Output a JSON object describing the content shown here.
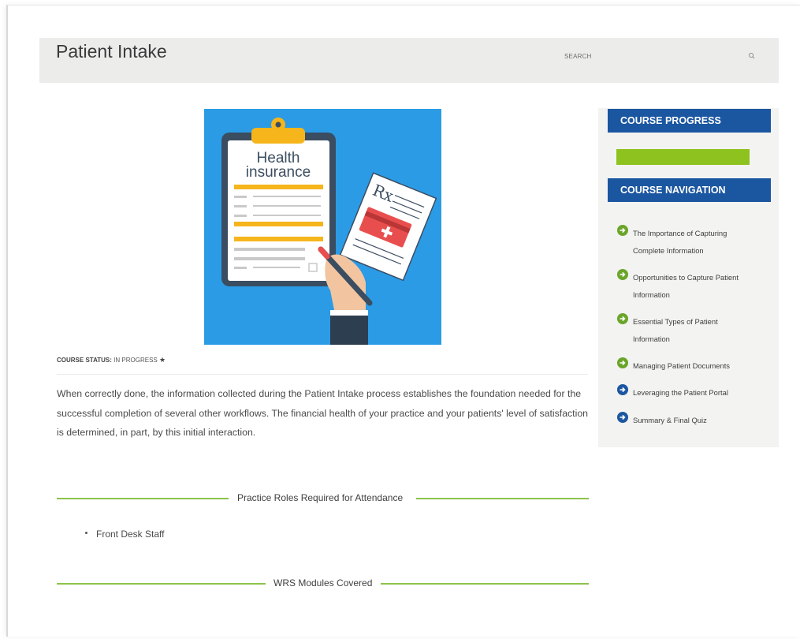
{
  "header": {
    "title": "Patient Intake",
    "search_label": "SEARCH",
    "search_icon": "search-icon"
  },
  "hero_image": {
    "title_line1": "Health",
    "title_line2": "insurance",
    "rx_label": "Rx",
    "colors": {
      "background": "#2b9be6",
      "clipboard": "#3b4d61",
      "accent": "#f5b51b",
      "card": "#e94e4e"
    }
  },
  "course_status": {
    "label": "COURSE STATUS:",
    "value": "IN PROGRESS",
    "icon": "star-icon"
  },
  "intro_text": "When correctly done, the information collected during the Patient Intake process establishes the foundation needed for the successful completion of several other workflows. The financial health of your practice and your patients' level of satisfaction is determined, in part, by this initial interaction.",
  "sections": [
    {
      "title": "Practice Roles Required for Attendance",
      "items": [
        "Front Desk Staff"
      ]
    },
    {
      "title": "WRS Modules Covered",
      "items": []
    }
  ],
  "sidebar": {
    "progress_heading": "COURSE PROGRESS",
    "progress_fraction": 1.0,
    "navigation_heading": "COURSE NAVIGATION",
    "items": [
      {
        "line1": "The Importance of Capturing",
        "line2": "Complete Information",
        "status": "complete",
        "icon": "arrow-right-circle-icon"
      },
      {
        "line1": "Opportunities to Capture Patient",
        "line2": "Information",
        "status": "complete",
        "icon": "arrow-right-circle-icon"
      },
      {
        "line1": "Essential Types of Patient",
        "line2": "Information",
        "status": "complete",
        "icon": "arrow-right-circle-icon"
      },
      {
        "line1": "Managing Patient Documents",
        "line2": "",
        "status": "complete",
        "icon": "arrow-right-circle-icon"
      },
      {
        "line1": "Leveraging the Patient Portal",
        "line2": "",
        "status": "incomplete",
        "icon": "arrow-right-circle-icon"
      },
      {
        "line1": "Summary & Final Quiz",
        "line2": "",
        "status": "incomplete",
        "icon": "arrow-right-circle-icon"
      }
    ]
  },
  "colors": {
    "accent_blue": "#1b56a1",
    "progress_green": "#8dc21f",
    "complete_icon": "#6aa52a",
    "incomplete_icon": "#1b56a1",
    "section_line": "#8bc34a"
  }
}
